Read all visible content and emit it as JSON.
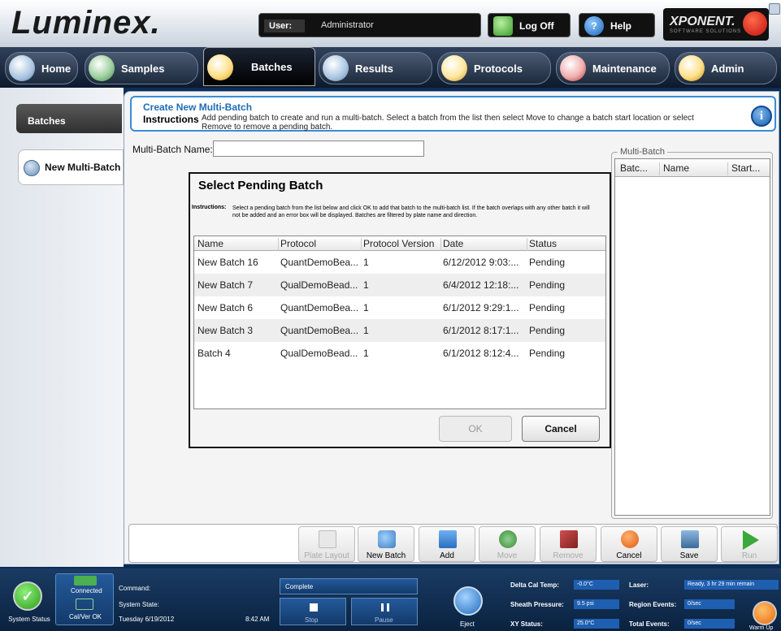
{
  "header": {
    "logo": "Luminex.",
    "user_label": "User:",
    "user_name": "Administrator",
    "logoff_label": "Log Off",
    "help_label": "Help",
    "xponent": "XPONENT.",
    "xponent_sub": "SOFTWARE SOLUTIONS"
  },
  "nav": {
    "tabs": [
      {
        "label": "Home"
      },
      {
        "label": "Samples"
      },
      {
        "label": "Batches"
      },
      {
        "label": "Results"
      },
      {
        "label": "Protocols"
      },
      {
        "label": "Maintenance"
      },
      {
        "label": "Admin"
      }
    ]
  },
  "sidebar": {
    "batches_label": "Batches",
    "item_label": "New Multi-Batch"
  },
  "page": {
    "title": "Create New Multi-Batch",
    "instructions_label": "Instructions",
    "instructions_text": "Add pending batch to create and run a multi-batch. Select a batch from the list then select Move to change a batch start location or select Remove to remove a pending batch.",
    "name_label": "Multi-Batch Name:",
    "name_value": ""
  },
  "multibatch": {
    "legend": "Multi-Batch",
    "columns": [
      "Batc...",
      "Name",
      "Start..."
    ]
  },
  "dialog": {
    "title": "Select Pending Batch",
    "instr_label": "Instructions:",
    "instr_text": "Select a pending batch from the list below and click OK to add that batch to the multi-batch list. If the batch overlaps with any other batch it will not be added and an error box will be displayed. Batches are filtered by plate name and direction.",
    "columns": [
      "Name",
      "Protocol",
      "Protocol Version",
      "Date",
      "Status"
    ],
    "rows": [
      [
        "New Batch 16",
        "QuantDemoBea...",
        "1",
        "6/12/2012 9:03:...",
        "Pending"
      ],
      [
        "New Batch 7",
        "QualDemoBead...",
        "1",
        "6/4/2012 12:18:...",
        "Pending"
      ],
      [
        "New Batch 6",
        "QuantDemoBea...",
        "1",
        "6/1/2012 9:29:1...",
        "Pending"
      ],
      [
        "New Batch 3",
        "QuantDemoBea...",
        "1",
        "6/1/2012 8:17:1...",
        "Pending"
      ],
      [
        "Batch 4",
        "QualDemoBead...",
        "1",
        "6/1/2012 8:12:4...",
        "Pending"
      ]
    ],
    "ok_label": "OK",
    "cancel_label": "Cancel"
  },
  "toolbar": {
    "buttons": [
      {
        "label": "Plate Layout",
        "enabled": false
      },
      {
        "label": "New Batch",
        "enabled": true
      },
      {
        "label": "Add",
        "enabled": true
      },
      {
        "label": "Move",
        "enabled": false
      },
      {
        "label": "Remove",
        "enabled": false
      },
      {
        "label": "Cancel",
        "enabled": true
      },
      {
        "label": "Save",
        "enabled": true
      },
      {
        "label": "Run",
        "enabled": false
      }
    ]
  },
  "status": {
    "system_status": "System Status",
    "connected": "Connected",
    "calver": "Cal/Ver OK",
    "command_label": "Command:",
    "system_state_label": "System State:",
    "date": "Tuesday 6/19/2012",
    "time": "8:42 AM",
    "progress_label": "Complete",
    "stop_label": "Stop",
    "pause_label": "Pause",
    "eject_label": "Eject",
    "delta_cal_label": "Delta Cal Temp:",
    "delta_cal_value": "-0.0°C",
    "sheath_label": "Sheath Pressure:",
    "sheath_value": "9.5 psi",
    "xy_label": "XY Status:",
    "xy_value": "25.0°C",
    "laser_label": "Laser:",
    "laser_value": "Ready, 3 hr 29 min remain",
    "region_label": "Region Events:",
    "region_value": "0/sec",
    "total_label": "Total Events:",
    "total_value": "0/sec",
    "warmup_label": "Warm Up"
  }
}
